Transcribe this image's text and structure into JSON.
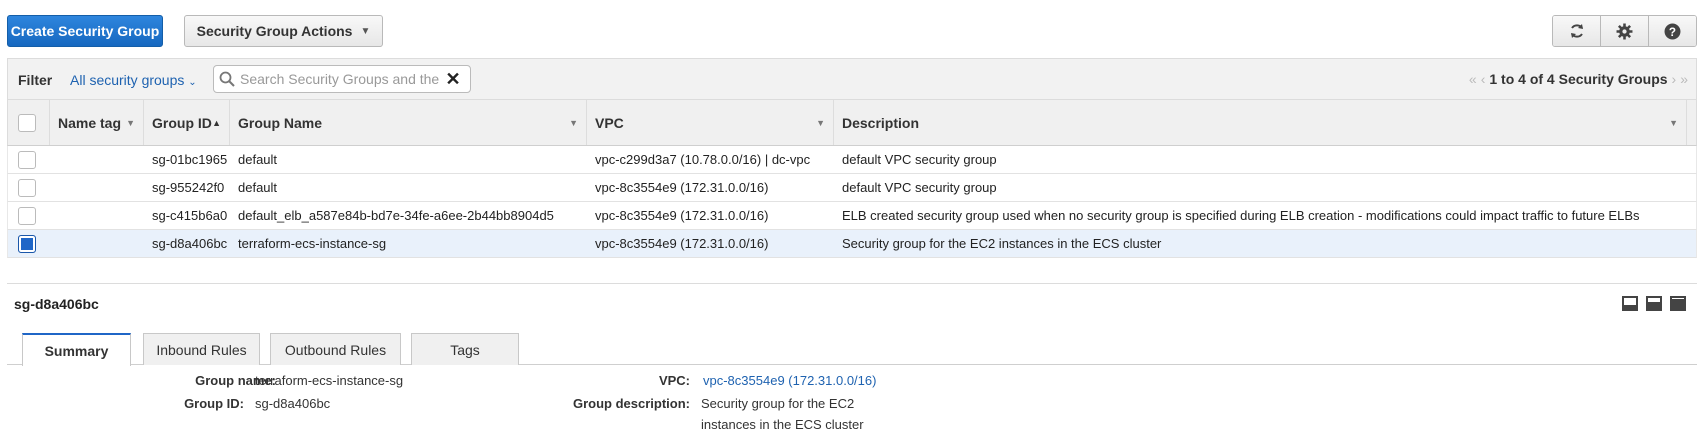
{
  "toolbar": {
    "create_label": "Create Security Group",
    "actions_label": "Security Group Actions",
    "icons": [
      "refresh-icon",
      "gear-icon",
      "help-icon"
    ]
  },
  "filter": {
    "label": "Filter",
    "dropdown": "All security groups",
    "search_placeholder": "Search Security Groups and their properties",
    "pager_text": "1 to 4 of 4 Security Groups"
  },
  "table": {
    "headers": {
      "name_tag": "Name tag",
      "group_id": "Group ID",
      "group_name": "Group Name",
      "vpc": "VPC",
      "description": "Description"
    },
    "rows": [
      {
        "group_id": "sg-01bc1965",
        "group_name": "default",
        "vpc": "vpc-c299d3a7 (10.78.0.0/16) | dc-vpc",
        "description": "default VPC security group",
        "selected": false
      },
      {
        "group_id": "sg-955242f0",
        "group_name": "default",
        "vpc": "vpc-8c3554e9 (172.31.0.0/16)",
        "description": "default VPC security group",
        "selected": false
      },
      {
        "group_id": "sg-c415b6a0",
        "group_name": "default_elb_a587e84b-bd7e-34fe-a6ee-2b44bb8904d5",
        "vpc": "vpc-8c3554e9 (172.31.0.0/16)",
        "description": "ELB created security group used when no security group is specified during ELB creation - modifications could impact traffic to future ELBs",
        "selected": false
      },
      {
        "group_id": "sg-d8a406bc",
        "group_name": "terraform-ecs-instance-sg",
        "vpc": "vpc-8c3554e9 (172.31.0.0/16)",
        "description": "Security group for the EC2 instances in the ECS cluster",
        "selected": true
      }
    ]
  },
  "detail": {
    "title": "sg-d8a406bc",
    "tabs": [
      "Summary",
      "Inbound Rules",
      "Outbound Rules",
      "Tags"
    ],
    "active_tab": "Summary",
    "group_name_label": "Group name:",
    "group_name_value": "terraform-ecs-instance-sg",
    "group_id_label": "Group ID:",
    "group_id_value": "sg-d8a406bc",
    "vpc_label": "VPC:",
    "vpc_value": "vpc-8c3554e9 (172.31.0.0/16)",
    "desc_label": "Group description:",
    "desc_line1": "Security group for the EC2",
    "desc_line2": "instances in the ECS cluster"
  },
  "colors": {
    "accent": "#1f66c7",
    "link": "#1e62b0",
    "selected_row": "#e9f1fb"
  }
}
